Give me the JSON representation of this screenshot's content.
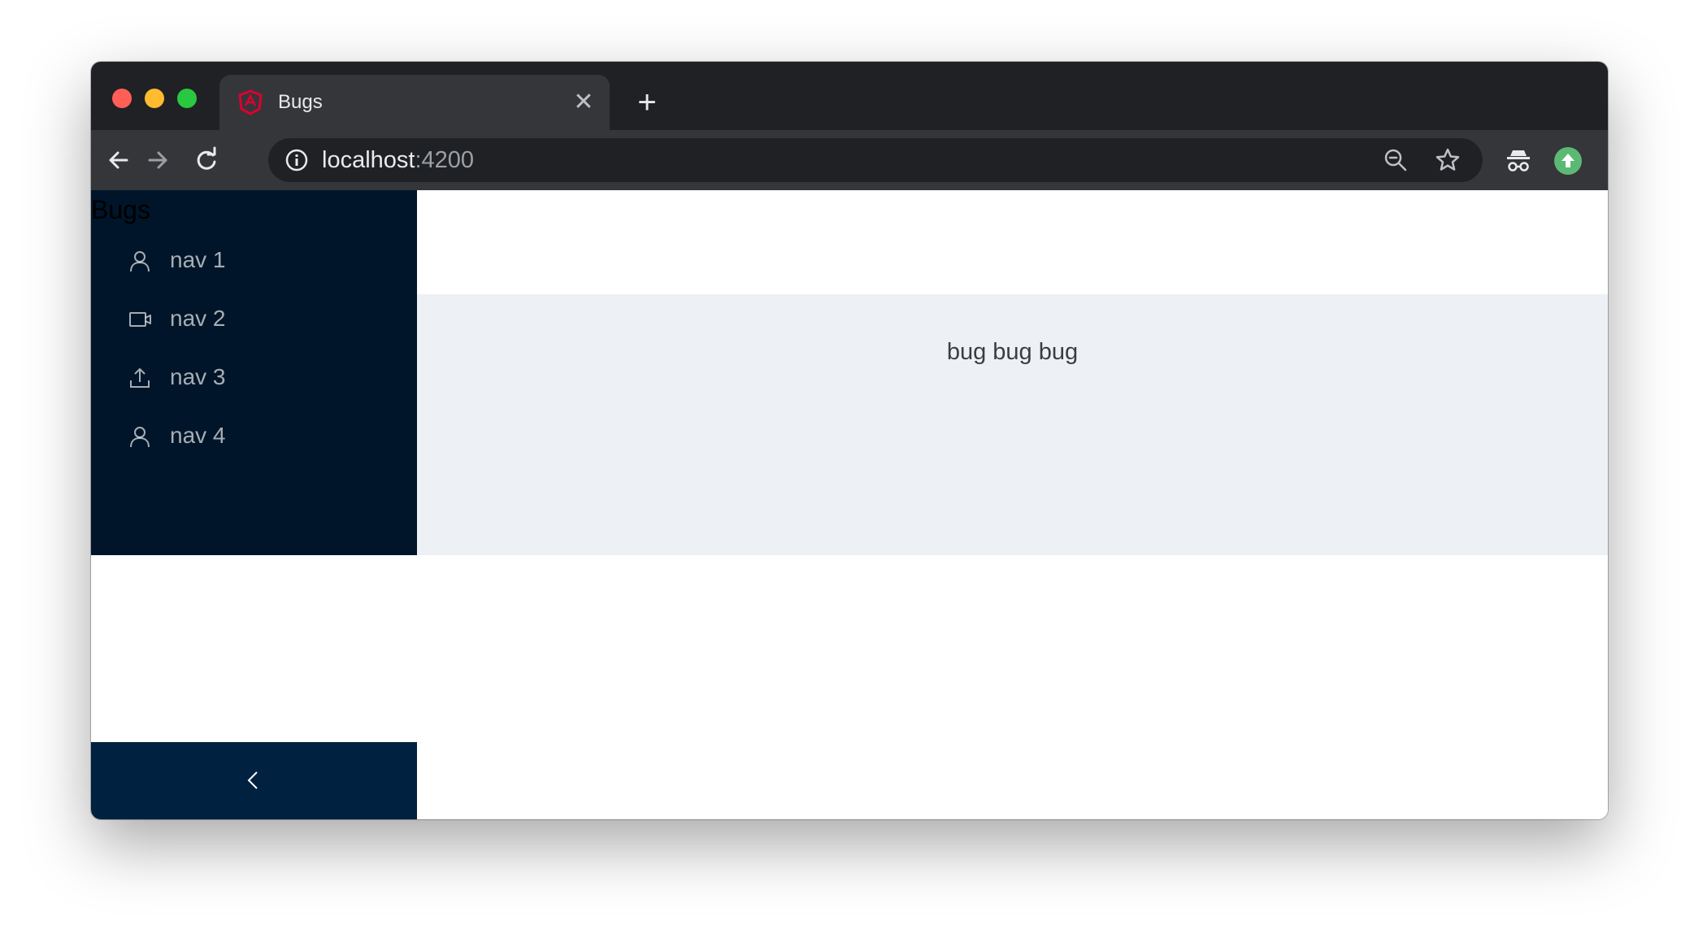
{
  "browser": {
    "tab": {
      "title": "Bugs",
      "close": "✕"
    },
    "newtab": "+",
    "url": {
      "host": "localhost",
      "port": ":4200"
    }
  },
  "sider": {
    "logo": "Bugs",
    "items": [
      {
        "label": "nav 1",
        "icon": "user-icon"
      },
      {
        "label": "nav 2",
        "icon": "video-camera-icon"
      },
      {
        "label": "nav 3",
        "icon": "upload-icon"
      },
      {
        "label": "nav 4",
        "icon": "user-icon"
      }
    ],
    "collapse_icon": "chevron-left-icon"
  },
  "content": {
    "text": "bug bug bug"
  },
  "colors": {
    "sider_bg": "#001529",
    "trigger_bg": "#002140",
    "content_bg": "#edf0f5",
    "profile": "#5bb974"
  }
}
